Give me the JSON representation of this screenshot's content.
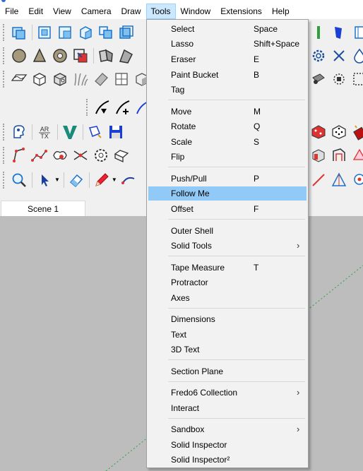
{
  "menubar": [
    {
      "label": "File"
    },
    {
      "label": "Edit"
    },
    {
      "label": "View"
    },
    {
      "label": "Camera"
    },
    {
      "label": "Draw"
    },
    {
      "label": "Tools"
    },
    {
      "label": "Window"
    },
    {
      "label": "Extensions"
    },
    {
      "label": "Help"
    }
  ],
  "active_menu": "Tools",
  "scene_tab": "Scene 1",
  "tools_menu": [
    {
      "label": "Select",
      "shortcut": "Space"
    },
    {
      "label": "Lasso",
      "shortcut": "Shift+Space"
    },
    {
      "label": "Eraser",
      "shortcut": "E"
    },
    {
      "label": "Paint Bucket",
      "shortcut": "B"
    },
    {
      "label": "Tag",
      "shortcut": ""
    },
    {
      "label": "Move",
      "shortcut": "M"
    },
    {
      "label": "Rotate",
      "shortcut": "Q"
    },
    {
      "label": "Scale",
      "shortcut": "S"
    },
    {
      "label": "Flip",
      "shortcut": ""
    },
    {
      "label": "Push/Pull",
      "shortcut": "P"
    },
    {
      "label": "Follow Me",
      "shortcut": "",
      "highlighted": true
    },
    {
      "label": "Offset",
      "shortcut": "F"
    },
    {
      "label": "Outer Shell",
      "shortcut": ""
    },
    {
      "label": "Solid Tools",
      "shortcut": "",
      "submenu": true
    },
    {
      "label": "Tape Measure",
      "shortcut": "T"
    },
    {
      "label": "Protractor",
      "shortcut": ""
    },
    {
      "label": "Axes",
      "shortcut": ""
    },
    {
      "label": "Dimensions",
      "shortcut": ""
    },
    {
      "label": "Text",
      "shortcut": ""
    },
    {
      "label": "3D Text",
      "shortcut": ""
    },
    {
      "label": "Section Plane",
      "shortcut": ""
    },
    {
      "label": "Fredo6 Collection",
      "shortcut": "",
      "submenu": true
    },
    {
      "label": "Interact",
      "shortcut": ""
    },
    {
      "label": "Sandbox",
      "shortcut": "",
      "submenu": true
    },
    {
      "label": "Solid Inspector",
      "shortcut": ""
    },
    {
      "label": "Solid Inspector²",
      "shortcut": ""
    }
  ],
  "submenu_glyph": "›",
  "toolbar_text": {
    "artx": "AR\nTX"
  },
  "colors": {
    "highlight": "#91c9f7",
    "menu_open": "#cce8ff",
    "viewport": "#bdbdbd",
    "axis_green": "#2e9e3e"
  }
}
